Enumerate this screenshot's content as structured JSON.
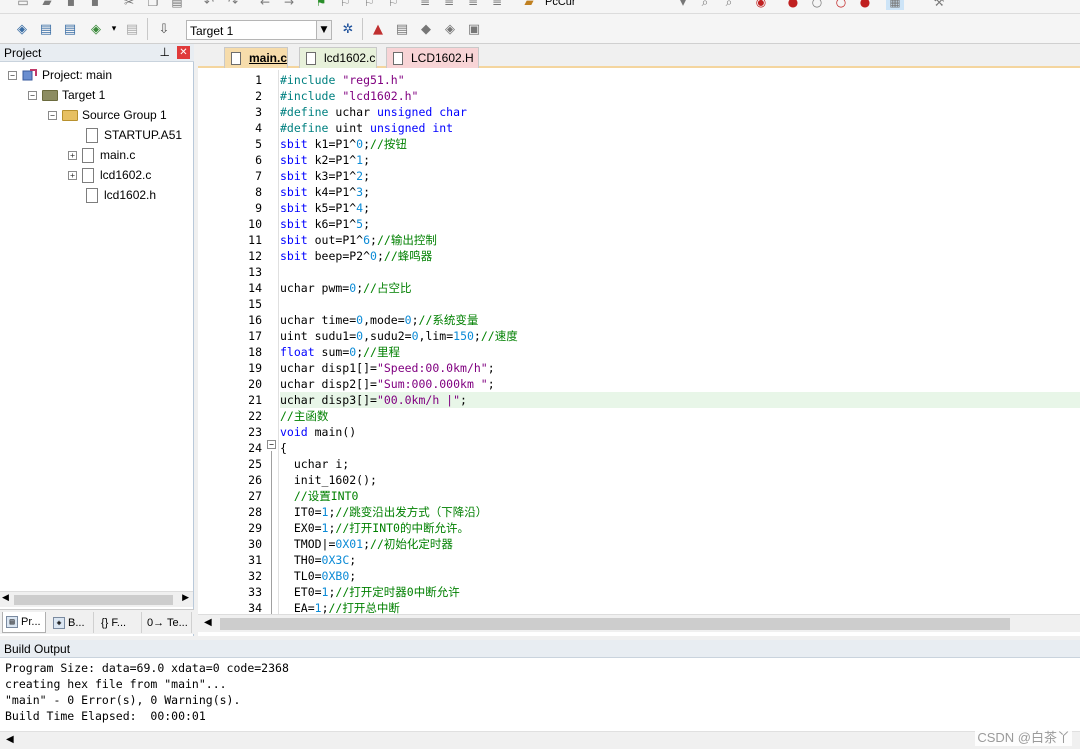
{
  "toolbar": {
    "target_select_value": "Target 1",
    "top_select_value": "PcCur"
  },
  "project": {
    "panel_title": "Project",
    "tree": [
      {
        "label": "Project: main"
      },
      {
        "label": "Target 1"
      },
      {
        "label": "Source Group 1"
      },
      {
        "label": "STARTUP.A51"
      },
      {
        "label": "main.c"
      },
      {
        "label": "lcd1602.c"
      },
      {
        "label": "lcd1602.h"
      }
    ],
    "bottom_tabs": [
      "Pr...",
      "B...",
      "{} F...",
      "0→ Te..."
    ]
  },
  "editor": {
    "tabs": [
      "main.c",
      "lcd1602.c",
      "LCD1602.H"
    ],
    "active_tab": "main.c",
    "current_line": 21,
    "lines": [
      "1",
      "2",
      "3",
      "4",
      "5",
      "6",
      "7",
      "8",
      "9",
      "10",
      "11",
      "12",
      "13",
      "14",
      "15",
      "16",
      "17",
      "18",
      "19",
      "20",
      "21",
      "22",
      "23",
      "24",
      "25",
      "26",
      "27",
      "28",
      "29",
      "30",
      "31",
      "32",
      "33",
      "34"
    ],
    "code": [
      [
        {
          "c": "pp",
          "t": "#include "
        },
        {
          "c": "str",
          "t": "\"reg51.h\""
        }
      ],
      [
        {
          "c": "pp",
          "t": "#include "
        },
        {
          "c": "str",
          "t": "\"lcd1602.h\""
        }
      ],
      [
        {
          "c": "pp",
          "t": "#define "
        },
        {
          "c": "",
          "t": "uchar "
        },
        {
          "c": "kw",
          "t": "unsigned char"
        }
      ],
      [
        {
          "c": "pp",
          "t": "#define "
        },
        {
          "c": "",
          "t": "uint "
        },
        {
          "c": "kw",
          "t": "unsigned int"
        }
      ],
      [
        {
          "c": "kw",
          "t": "sbit "
        },
        {
          "c": "",
          "t": "k1=P1^"
        },
        {
          "c": "num",
          "t": "0"
        },
        {
          "c": "",
          "t": ";"
        },
        {
          "c": "cm",
          "t": "//按钮"
        }
      ],
      [
        {
          "c": "kw",
          "t": "sbit "
        },
        {
          "c": "",
          "t": "k2=P1^"
        },
        {
          "c": "num",
          "t": "1"
        },
        {
          "c": "",
          "t": ";"
        }
      ],
      [
        {
          "c": "kw",
          "t": "sbit "
        },
        {
          "c": "",
          "t": "k3=P1^"
        },
        {
          "c": "num",
          "t": "2"
        },
        {
          "c": "",
          "t": ";"
        }
      ],
      [
        {
          "c": "kw",
          "t": "sbit "
        },
        {
          "c": "",
          "t": "k4=P1^"
        },
        {
          "c": "num",
          "t": "3"
        },
        {
          "c": "",
          "t": ";"
        }
      ],
      [
        {
          "c": "kw",
          "t": "sbit "
        },
        {
          "c": "",
          "t": "k5=P1^"
        },
        {
          "c": "num",
          "t": "4"
        },
        {
          "c": "",
          "t": ";"
        }
      ],
      [
        {
          "c": "kw",
          "t": "sbit "
        },
        {
          "c": "",
          "t": "k6=P1^"
        },
        {
          "c": "num",
          "t": "5"
        },
        {
          "c": "",
          "t": ";"
        }
      ],
      [
        {
          "c": "kw",
          "t": "sbit "
        },
        {
          "c": "",
          "t": "out=P1^"
        },
        {
          "c": "num",
          "t": "6"
        },
        {
          "c": "",
          "t": ";"
        },
        {
          "c": "cm",
          "t": "//输出控制"
        }
      ],
      [
        {
          "c": "kw",
          "t": "sbit "
        },
        {
          "c": "",
          "t": "beep=P2^"
        },
        {
          "c": "num",
          "t": "0"
        },
        {
          "c": "",
          "t": ";"
        },
        {
          "c": "cm",
          "t": "//蜂鸣器"
        }
      ],
      [],
      [
        {
          "c": "",
          "t": "uchar pwm="
        },
        {
          "c": "num",
          "t": "0"
        },
        {
          "c": "",
          "t": ";"
        },
        {
          "c": "cm",
          "t": "//占空比"
        }
      ],
      [],
      [
        {
          "c": "",
          "t": "uchar time="
        },
        {
          "c": "num",
          "t": "0"
        },
        {
          "c": "",
          "t": ",mode="
        },
        {
          "c": "num",
          "t": "0"
        },
        {
          "c": "",
          "t": ";"
        },
        {
          "c": "cm",
          "t": "//系统变量"
        }
      ],
      [
        {
          "c": "",
          "t": "uint sudu1="
        },
        {
          "c": "num",
          "t": "0"
        },
        {
          "c": "",
          "t": ",sudu2="
        },
        {
          "c": "num",
          "t": "0"
        },
        {
          "c": "",
          "t": ",lim="
        },
        {
          "c": "num",
          "t": "150"
        },
        {
          "c": "",
          "t": ";"
        },
        {
          "c": "cm",
          "t": "//速度"
        }
      ],
      [
        {
          "c": "kw",
          "t": "float "
        },
        {
          "c": "",
          "t": "sum="
        },
        {
          "c": "num",
          "t": "0"
        },
        {
          "c": "",
          "t": ";"
        },
        {
          "c": "cm",
          "t": "//里程"
        }
      ],
      [
        {
          "c": "",
          "t": "uchar disp1[]="
        },
        {
          "c": "str",
          "t": "\"Speed:00.0km/h\""
        },
        {
          "c": "",
          "t": ";"
        }
      ],
      [
        {
          "c": "",
          "t": "uchar disp2[]="
        },
        {
          "c": "str",
          "t": "\"Sum:000.000km \""
        },
        {
          "c": "",
          "t": ";"
        }
      ],
      [
        {
          "c": "",
          "t": "uchar disp3[]="
        },
        {
          "c": "str",
          "t": "\"00.0km/h |\""
        },
        {
          "c": "",
          "t": ";"
        }
      ],
      [
        {
          "c": "cm",
          "t": "//主函数"
        }
      ],
      [
        {
          "c": "kw",
          "t": "void "
        },
        {
          "c": "",
          "t": "main()"
        }
      ],
      [
        {
          "c": "",
          "t": "{"
        }
      ],
      [
        {
          "c": "",
          "t": "  uchar i;"
        }
      ],
      [
        {
          "c": "",
          "t": "  init_1602();"
        }
      ],
      [
        {
          "c": "cm",
          "t": "  //设置INT0"
        }
      ],
      [
        {
          "c": "",
          "t": "  IT0="
        },
        {
          "c": "num",
          "t": "1"
        },
        {
          "c": "",
          "t": ";"
        },
        {
          "c": "cm",
          "t": "//跳变沿出发方式（下降沿）"
        }
      ],
      [
        {
          "c": "",
          "t": "  EX0="
        },
        {
          "c": "num",
          "t": "1"
        },
        {
          "c": "",
          "t": ";"
        },
        {
          "c": "cm",
          "t": "//打开INT0的中断允许。"
        }
      ],
      [
        {
          "c": "",
          "t": "  TMOD|="
        },
        {
          "c": "num",
          "t": "0X01"
        },
        {
          "c": "",
          "t": ";"
        },
        {
          "c": "cm",
          "t": "//初始化定时器"
        }
      ],
      [
        {
          "c": "",
          "t": "  TH0="
        },
        {
          "c": "num",
          "t": "0X3C"
        },
        {
          "c": "",
          "t": ";"
        }
      ],
      [
        {
          "c": "",
          "t": "  TL0="
        },
        {
          "c": "num",
          "t": "0XB0"
        },
        {
          "c": "",
          "t": ";"
        }
      ],
      [
        {
          "c": "",
          "t": "  ET0="
        },
        {
          "c": "num",
          "t": "1"
        },
        {
          "c": "",
          "t": ";"
        },
        {
          "c": "cm",
          "t": "//打开定时器0中断允许"
        }
      ],
      [
        {
          "c": "",
          "t": "  EA="
        },
        {
          "c": "num",
          "t": "1"
        },
        {
          "c": "",
          "t": ";"
        },
        {
          "c": "cm",
          "t": "//打开总中断"
        }
      ]
    ]
  },
  "build": {
    "title": "Build Output",
    "lines": [
      "Program Size: data=69.0 xdata=0 code=2368",
      "creating hex file from \"main\"...",
      "\"main\" - 0 Error(s), 0 Warning(s).",
      "Build Time Elapsed:  00:00:01"
    ]
  },
  "watermark": "CSDN @白茶丫",
  "colors": {
    "keyword": "#0000ff",
    "preprocessor": "#008080",
    "string": "#800080",
    "number": "#0a8ad6",
    "comment": "#008000",
    "current_line": "#e8f6e8"
  }
}
